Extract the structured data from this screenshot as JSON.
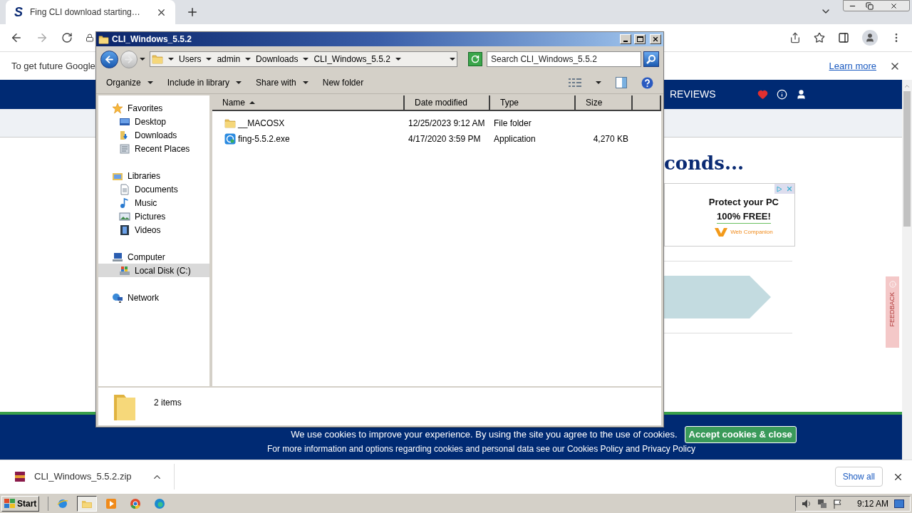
{
  "browser": {
    "tab": {
      "favicon": "S",
      "title": "Fing CLI download starting…"
    },
    "infobar": {
      "text": "To get future Google",
      "link": "Learn more"
    }
  },
  "site": {
    "nav": {
      "label": "REVIEWS"
    },
    "heading": "conds...",
    "ad": {
      "line1": "Protect your PC",
      "line2": "100% FREE!",
      "brand": "Web Companion"
    },
    "feedback": "FEEDBACK",
    "cookie": {
      "text": "We use cookies to improve your experience. By using the site you agree to the use of cookies.",
      "button": "Accept cookies & close",
      "more": "For more information and options regarding cookies and personal data see our Cookies Policy and Privacy Policy"
    }
  },
  "explorer": {
    "title": "CLI_Windows_5.5.2",
    "breadcrumb": [
      "Users",
      "admin",
      "Downloads",
      "CLI_Windows_5.5.2"
    ],
    "search": {
      "placeholder": "Search CLI_Windows_5.5.2"
    },
    "toolbar": [
      {
        "label": "Organize",
        "menu": true
      },
      {
        "label": "Include in library",
        "menu": true
      },
      {
        "label": "Share with",
        "menu": true
      },
      {
        "label": "New folder",
        "menu": false
      }
    ],
    "nav": [
      {
        "label": "Favorites",
        "selected": false,
        "children": [
          {
            "label": "Desktop",
            "selected": false
          },
          {
            "label": "Downloads",
            "selected": false
          },
          {
            "label": "Recent Places",
            "selected": false
          }
        ]
      },
      {
        "label": "Libraries",
        "selected": false,
        "children": [
          {
            "label": "Documents",
            "selected": false
          },
          {
            "label": "Music",
            "selected": false
          },
          {
            "label": "Pictures",
            "selected": false
          },
          {
            "label": "Videos",
            "selected": false
          }
        ]
      },
      {
        "label": "Computer",
        "selected": false,
        "children": [
          {
            "label": "Local Disk (C:)",
            "selected": true
          }
        ]
      },
      {
        "label": "Network",
        "selected": false
      }
    ],
    "columns": [
      {
        "label": "Name",
        "sorted": true
      },
      {
        "label": "Date modified",
        "sorted": false
      },
      {
        "label": "Type",
        "sorted": false
      },
      {
        "label": "Size",
        "sorted": false
      }
    ],
    "files": [
      {
        "kind": "folder",
        "name": "__MACOSX",
        "date": "12/25/2023 9:12 AM",
        "type": "File folder"
      },
      {
        "kind": "application",
        "name": "fing-5.5.2.exe",
        "date": "4/17/2020 3:59 PM",
        "type": "Application",
        "size": "4,270 KB"
      }
    ],
    "status": "2 items"
  },
  "downloads": {
    "file": "CLI_Windows_5.5.2.zip",
    "show_all": "Show all"
  },
  "taskbar": {
    "start": "Start",
    "apps": [
      {
        "selected": false
      },
      {
        "selected": true
      },
      {
        "selected": false
      },
      {
        "selected": false
      },
      {
        "selected": false
      }
    ],
    "clock": "9:12 AM"
  }
}
